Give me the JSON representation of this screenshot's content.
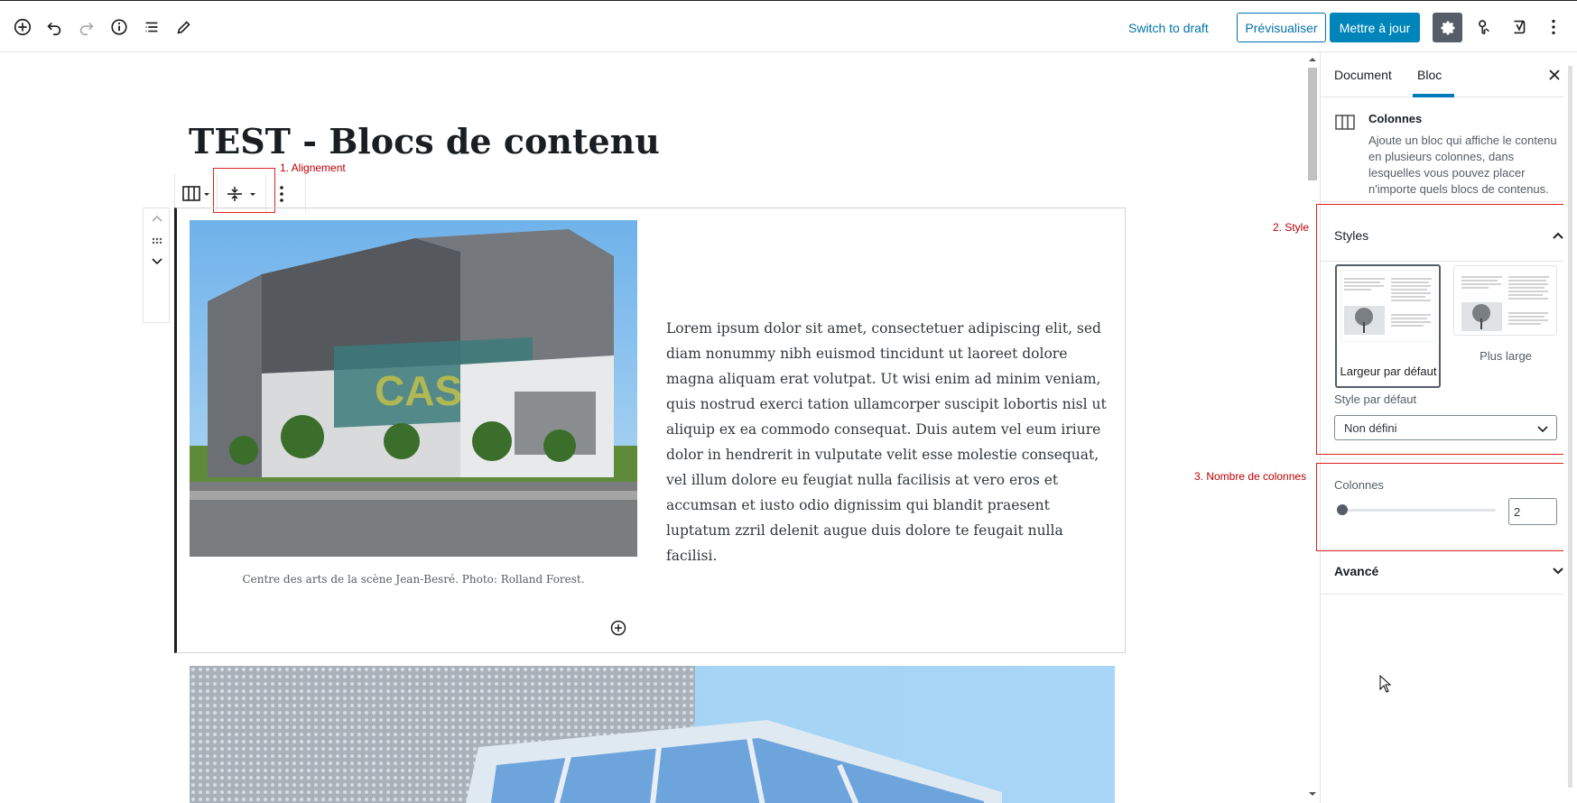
{
  "toolbar": {
    "switch_to_draft": "Switch to draft",
    "preview": "Prévisualiser",
    "update": "Mettre à jour"
  },
  "post": {
    "title": "TEST - Blocs de contenu",
    "paragraph": "Lorem ipsum dolor sit amet, consectetuer adipiscing elit, sed diam nonummy nibh euismod tincidunt ut laoreet dolore magna aliquam erat volutpat. Ut wisi enim ad minim veniam, quis nostrud exerci tation ullamcorper suscipit lobortis nisl ut aliquip ex ea commodo consequat. Duis autem vel eum iriure dolor in hendrerit in vulputate velit esse molestie consequat, vel illum dolore eu feugiat nulla facilisis at vero eros et accumsan et iusto odio dignissim qui blandit praesent luptatum zzril delenit augue duis dolore te feugait nulla facilisi.",
    "caption": "Centre des arts de la scène Jean-Besré. Photo: Rolland Forest.",
    "photo_sign": "CAS.JB"
  },
  "annotations": {
    "alignment": "1. Alignement",
    "style": "2. Style",
    "columns": "3. Nombre de colonnes"
  },
  "sidebar": {
    "tab_document": "Document",
    "tab_block": "Bloc",
    "block_name": "Colonnes",
    "block_description": "Ajoute un bloc qui affiche le contenu en plusieurs colonnes, dans lesquelles vous pouvez placer n'importe quels blocs de contenus.",
    "styles_header": "Styles",
    "style_default_label": "Largeur par défaut",
    "style_wide_label": "Plus large",
    "default_style_label": "Style par défaut",
    "default_style_value": "Non défini",
    "columns_label": "Colonnes",
    "columns_value": "2",
    "advanced_header": "Avancé"
  },
  "colors": {
    "accent": "#0085ba",
    "annotation": "#bb0000"
  }
}
